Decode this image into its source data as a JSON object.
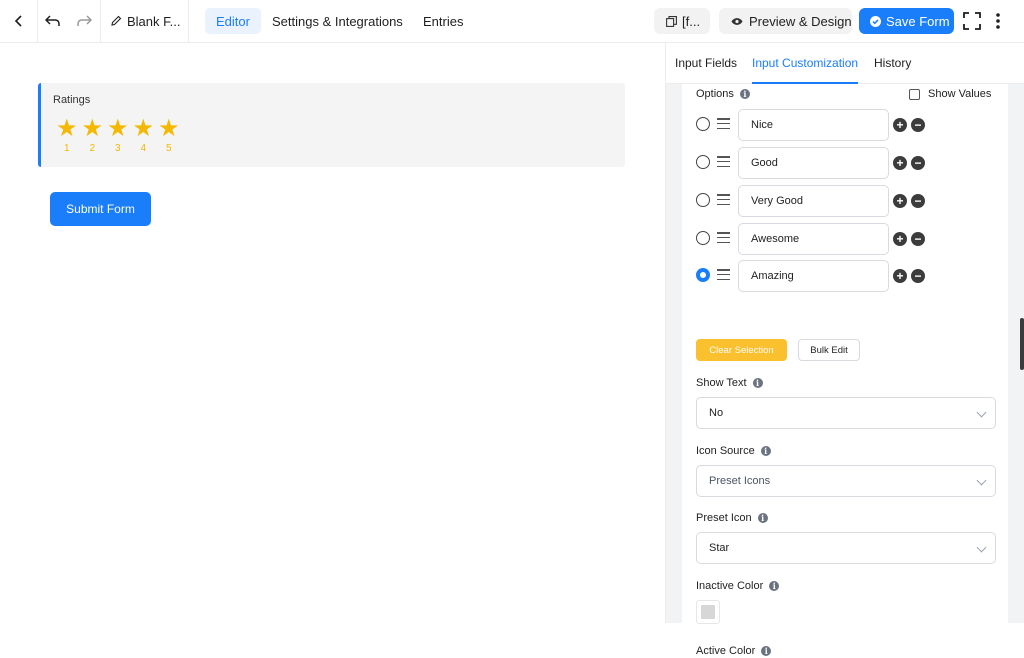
{
  "topbar": {
    "form_title": "Blank F...",
    "tabs": [
      "Editor",
      "Settings & Integrations",
      "Entries"
    ],
    "shortcode_label": "[f...",
    "preview_label": "Preview & Design",
    "save_label": "Save Form"
  },
  "canvas": {
    "field_label": "Ratings",
    "star_numbers": [
      "1",
      "2",
      "3",
      "4",
      "5"
    ],
    "star_color": "#f5b800",
    "submit_label": "Submit Form"
  },
  "panel": {
    "tabs": [
      "Input Fields",
      "Input Customization",
      "History"
    ],
    "options_label": "Options",
    "show_values_label": "Show Values",
    "options": [
      "Nice",
      "Good",
      "Very Good",
      "Awesome",
      "Amazing"
    ],
    "selected_option": "Amazing",
    "clear_selection_label": "Clear Selection",
    "bulk_edit_label": "Bulk Edit",
    "show_text_label": "Show Text",
    "show_text_value": "No",
    "icon_source_label": "Icon Source",
    "icon_source_value": "Preset Icons",
    "preset_icon_label": "Preset Icon",
    "preset_icon_value": "Star",
    "inactive_color_label": "Inactive Color",
    "inactive_color_value": "#d7d7d7",
    "active_color_label": "Active Color"
  },
  "colors": {
    "accent": "#1a7efb",
    "warning": "#fbc02d"
  }
}
